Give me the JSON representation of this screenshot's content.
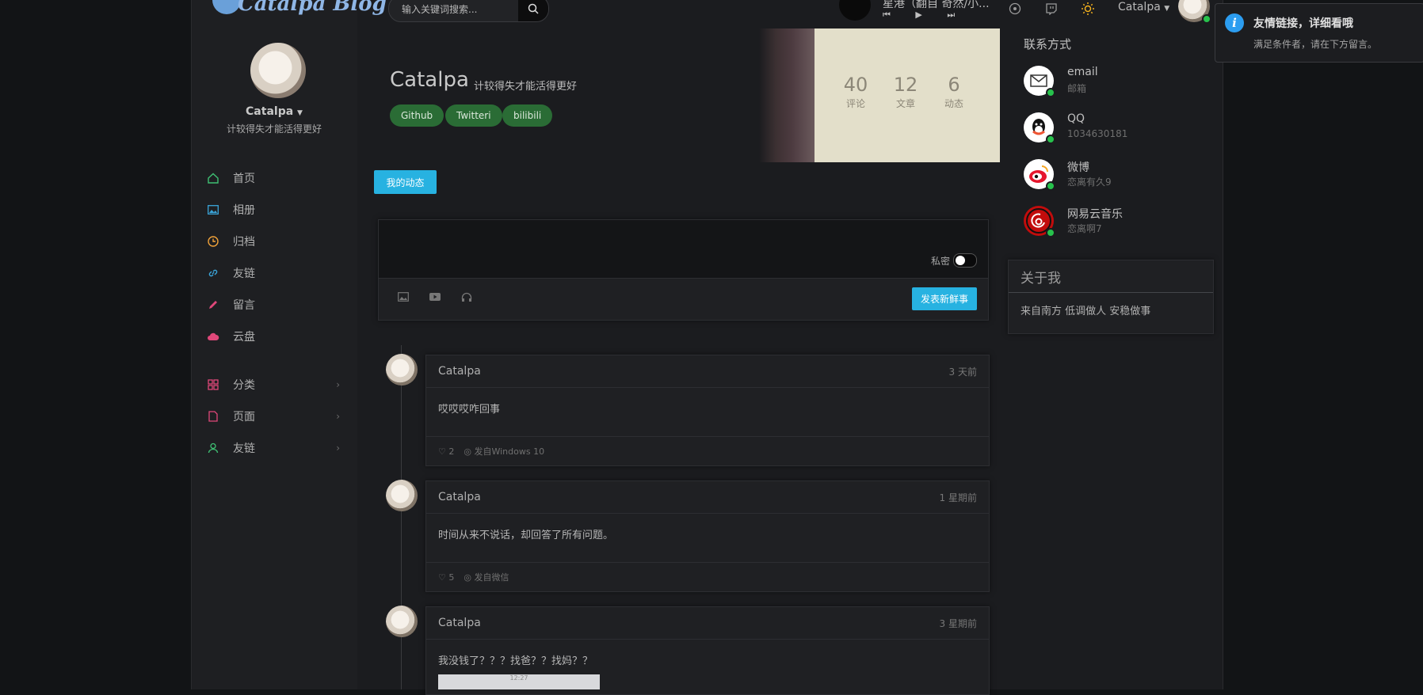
{
  "brand": {
    "logo": "Catalpa Blog"
  },
  "search": {
    "placeholder": "输入关键词搜索..."
  },
  "player": {
    "title": "星港（翻自 奇然/小...",
    "controls": "⏮ ▶ ⏭"
  },
  "header": {
    "user_name": "Catalpa"
  },
  "sidebar": {
    "name": "Catalpa",
    "subtitle": "计较得失才能活得更好",
    "items": [
      {
        "label": "首页",
        "icon": "home-icon",
        "color": "#3fbf73"
      },
      {
        "label": "相册",
        "icon": "image-icon",
        "color": "#3aa4d9"
      },
      {
        "label": "归档",
        "icon": "clock-icon",
        "color": "#f0a23a"
      },
      {
        "label": "友链",
        "icon": "link-icon",
        "color": "#3aa4d9"
      },
      {
        "label": "留言",
        "icon": "pencil-icon",
        "color": "#e0487a"
      },
      {
        "label": "云盘",
        "icon": "cloud-icon",
        "color": "#e0487a"
      }
    ],
    "groups": [
      {
        "label": "分类",
        "icon": "grid-icon",
        "color": "#e0487a"
      },
      {
        "label": "页面",
        "icon": "file-icon",
        "color": "#e0487a"
      },
      {
        "label": "友链",
        "icon": "user-icon",
        "color": "#3fbf73"
      }
    ]
  },
  "hero": {
    "title": "Catalpa",
    "subtitle": "计较得失才能活得更好",
    "tags": [
      "Github",
      "Twitteri",
      "bilibili"
    ],
    "stats": [
      {
        "value": "40",
        "label": "评论"
      },
      {
        "value": "12",
        "label": "文章"
      },
      {
        "value": "6",
        "label": "动态"
      }
    ]
  },
  "tabs": {
    "active": "我的动态"
  },
  "composer": {
    "private_label": "私密",
    "submit": "发表新鲜事"
  },
  "posts": [
    {
      "author": "Catalpa",
      "time": "3 天前",
      "content": "哎哎哎咋回事",
      "likes": "2",
      "source": "发自Windows 10"
    },
    {
      "author": "Catalpa",
      "time": "1 星期前",
      "content": "时间从来不说话，却回答了所有问题。",
      "likes": "5",
      "source": "发自微信"
    },
    {
      "author": "Catalpa",
      "time": "3 星期前",
      "content": "我没钱了？？？找爸？？找妈？？",
      "image_caption": "12:27"
    }
  ],
  "contacts": {
    "title": "联系方式",
    "items": [
      {
        "name": "email",
        "value": "邮箱"
      },
      {
        "name": "QQ",
        "value": "1034630181"
      },
      {
        "name": "微博",
        "value": "恋离有久9"
      },
      {
        "name": "网易云音乐",
        "value": "恋离啊7"
      }
    ]
  },
  "about": {
    "title": "关于我",
    "text": "来自南方 低调做人 安稳做事"
  },
  "toast": {
    "title": "友情链接，详细看哦",
    "text": "满足条件者，请在下方留言。"
  }
}
